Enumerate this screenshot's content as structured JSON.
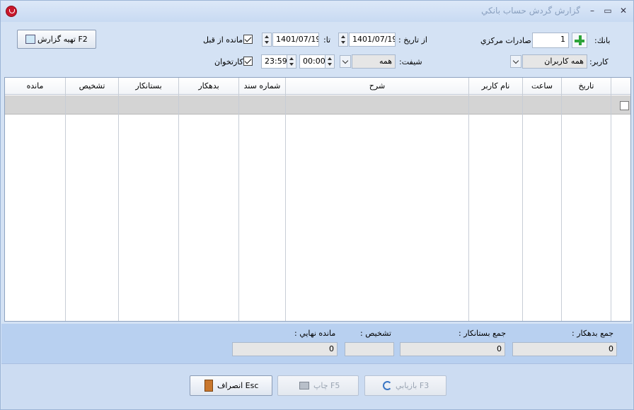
{
  "window": {
    "title": "گزارش گردش حساب بانكي"
  },
  "filters": {
    "bank_label": "بانك:",
    "bank_code": "1",
    "bank_name": "صادرات مركزي",
    "from_date_label": "از تاريخ :",
    "from_date": "1401/07/19",
    "to_date_label": "تا:",
    "to_date": "1401/07/19",
    "prev_balance_label": "مانده از قبل",
    "prev_balance_checked": true,
    "user_label": "كاربر:",
    "user_value": "همه كاربران",
    "shift_label": "شيفت:",
    "shift_value": "همه",
    "time_from": "00:00",
    "time_to": "23:59",
    "cardreader_label": "كارتخوان",
    "cardreader_checked": true
  },
  "report_button": {
    "label": "تهيه گزارش F2"
  },
  "grid": {
    "columns": [
      "تاريخ",
      "ساعت",
      "نام کاربر",
      "شرح",
      "شماره سند",
      "بدهكار",
      "بستانكار",
      "تشخيص",
      "مانده"
    ]
  },
  "totals": {
    "debit_label": "جمع بدهكار :",
    "debit_value": "0",
    "credit_label": "جمع بستانكار :",
    "credit_value": "0",
    "diag_label": "تشخيص :",
    "diag_value": "",
    "final_label": "مانده نهايي :",
    "final_value": "0"
  },
  "buttons": {
    "refresh": "بازيابي F3",
    "print": "چاپ F5",
    "cancel": "انصراف Esc"
  }
}
